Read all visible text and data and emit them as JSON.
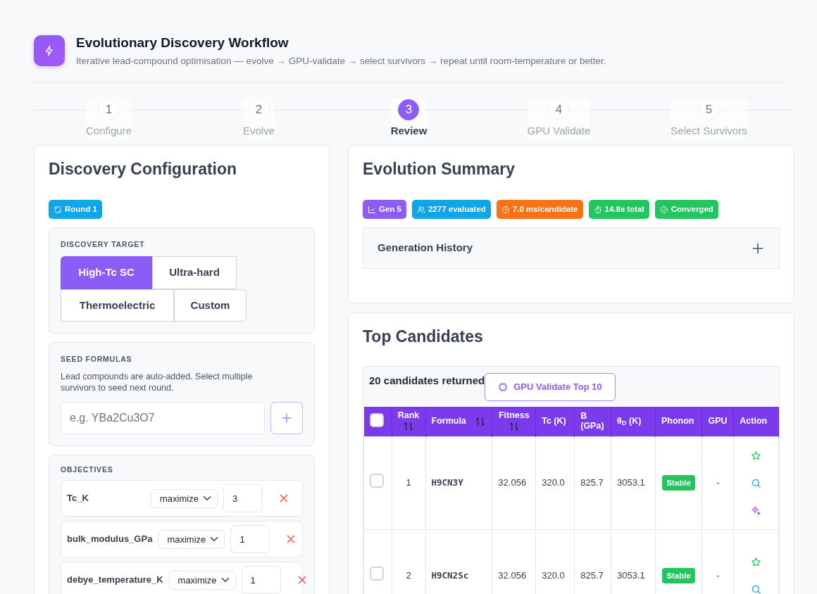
{
  "header": {
    "title": "Evolutionary Discovery Workflow",
    "subtitle": "Iterative lead-compound optimisation — evolve → GPU-validate → select survivors → repeat until room-temperature or better."
  },
  "steps": [
    {
      "number": "1",
      "label": "Configure",
      "selected": false
    },
    {
      "number": "2",
      "label": "Evolve",
      "selected": false
    },
    {
      "number": "3",
      "label": "Review",
      "selected": true
    },
    {
      "number": "4",
      "label": "GPU Validate",
      "selected": false
    },
    {
      "number": "5",
      "label": "Select Survivors",
      "selected": false
    }
  ],
  "config": {
    "title": "Discovery Configuration",
    "round_badge": "Round 1",
    "target": {
      "heading": "DISCOVERY TARGET",
      "options": [
        {
          "label": "High-Tc SC",
          "selected": true
        },
        {
          "label": "Ultra-hard",
          "selected": false
        },
        {
          "label": "Thermoelectric",
          "selected": false
        },
        {
          "label": "Custom",
          "selected": false
        }
      ]
    },
    "seed": {
      "heading": "SEED FORMULAS",
      "help": "Lead compounds are auto-added. Select multiple survivors to seed next round.",
      "placeholder": "e.g. YBa2Cu3O7"
    },
    "objectives": {
      "heading": "OBJECTIVES",
      "items": [
        {
          "name": "Tc_K",
          "direction": "maximize",
          "weight": "3"
        },
        {
          "name": "bulk_modulus_GPa",
          "direction": "maximize",
          "weight": "1"
        },
        {
          "name": "debye_temperature_K",
          "direction": "maximize",
          "weight": "1"
        }
      ]
    }
  },
  "summary": {
    "title": "Evolution Summary",
    "badges": [
      {
        "kind": "chart",
        "text": "Gen 5",
        "color": "#8b5cf6"
      },
      {
        "kind": "people",
        "text": "2277 evaluated",
        "color": "#0ea5e9"
      },
      {
        "kind": "clock",
        "text": "7.0 ms/candidate",
        "color": "#f97316"
      },
      {
        "kind": "timer",
        "text": "14.8s total",
        "color": "#22c55e"
      },
      {
        "kind": "check",
        "text": "Converged",
        "color": "#22c55e"
      }
    ],
    "accordion": {
      "title": "Generation History",
      "expanded": false
    }
  },
  "candidates": {
    "title": "Top Candidates",
    "count_text": "20 candidates returned",
    "validate_button": "GPU Validate Top 10",
    "select_all_checked": false,
    "columns": [
      {
        "label": "Rank",
        "sortable": true
      },
      {
        "label": "Formula",
        "sortable": true
      },
      {
        "label": "Fitness",
        "sortable": true
      },
      {
        "label": "Tc (K)",
        "sortable": false
      },
      {
        "label": "B (GPa)",
        "sortable": false
      },
      {
        "label": "θ$_{D}$ (K)",
        "sortable": false
      },
      {
        "label": "Phonon",
        "sortable": false
      },
      {
        "label": "GPU",
        "sortable": false
      },
      {
        "label": "Action",
        "sortable": false
      }
    ],
    "rows": [
      {
        "checked": false,
        "rank": "1",
        "formula": "H9CN3Y",
        "fitness": "32.056",
        "tc": "320.0",
        "b": "825.7",
        "theta": "3053.1",
        "phonon": "Stable",
        "gpu": "-",
        "actions": [
          {
            "kind": "star"
          },
          {
            "kind": "search"
          },
          {
            "kind": "sparkle"
          }
        ]
      },
      {
        "checked": false,
        "rank": "2",
        "formula": "H9CN2Sc",
        "fitness": "32.056",
        "tc": "320.0",
        "b": "825.7",
        "theta": "3053.1",
        "phonon": "Stable",
        "gpu": "-",
        "actions": [
          {
            "kind": "star"
          },
          {
            "kind": "search"
          }
        ]
      }
    ]
  }
}
